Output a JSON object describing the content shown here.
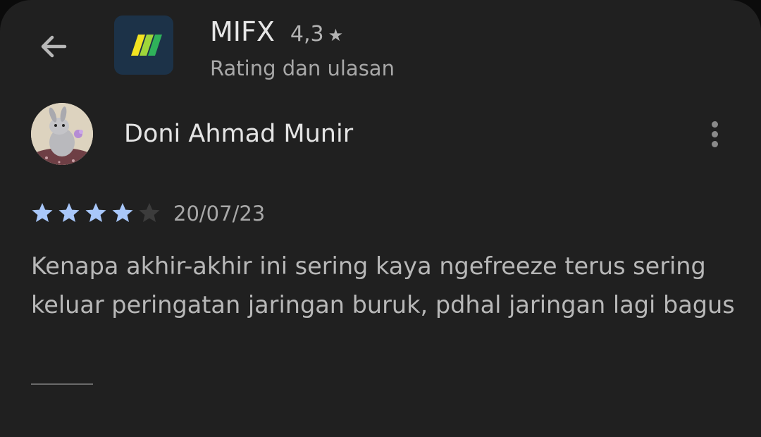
{
  "header": {
    "back_icon": "arrow-left-icon",
    "app_icon": "mifx-logo-icon",
    "app_name": "MIFX",
    "rating": "4,3",
    "rating_star": "★",
    "subtitle": "Rating dan ulasan"
  },
  "review": {
    "reviewer_name": "Doni Ahmad Munir",
    "avatar": "rabbit-avatar",
    "more_icon": "more-vert-icon",
    "stars_filled": 4,
    "stars_total": 5,
    "date": "20/07/23",
    "text": "Kenapa akhir-akhir ini sering kaya ngefreeze terus sering keluar peringatan jaringan buruk, pdhal jaringan lagi bagus"
  },
  "colors": {
    "background": "#202020",
    "star_filled": "#a8c7fa",
    "star_empty": "#3c3c3c",
    "app_icon_bg": "#1c3248"
  }
}
